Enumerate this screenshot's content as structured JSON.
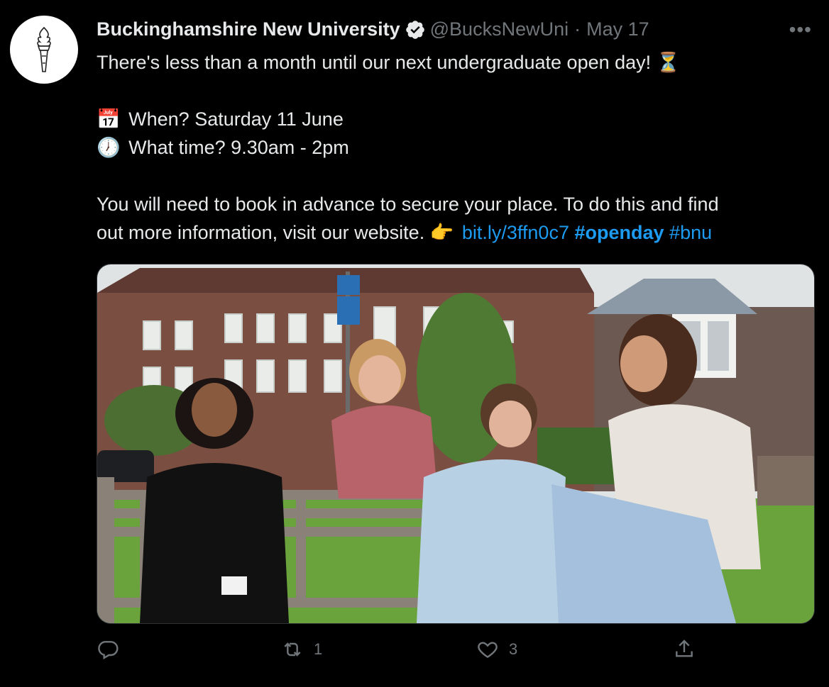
{
  "author": {
    "name": "Buckinghamshire New University",
    "handle": "@BucksNewUni",
    "separator": "·",
    "date": "May 17",
    "verified": true
  },
  "more_label": "•••",
  "text": {
    "line1": "There's less than a month until our next undergraduate open day!",
    "line1_emoji": "⏳",
    "when_emoji": "📅",
    "when": "When? Saturday 11 June",
    "time_emoji": "🕖",
    "time": "What time? 9.30am - 2pm",
    "book_line1": "You will need to book in advance to secure your place. To do this and find",
    "book_line2": "out more information, visit our website.",
    "pointer_emoji": "👉",
    "link": "bit.ly/3ffn0c7",
    "hashtag1": "#openday",
    "hashtag2": "#bnu"
  },
  "media": {
    "icon": "photo"
  },
  "actions": {
    "reply_icon": "reply-icon",
    "retweet_icon": "retweet-icon",
    "retweet_count": "1",
    "like_icon": "heart-icon",
    "like_count": "3",
    "share_icon": "share-icon"
  },
  "colors": {
    "background": "#000000",
    "text": "#e7e9ea",
    "muted": "#71767b",
    "link": "#1d9bf0"
  }
}
